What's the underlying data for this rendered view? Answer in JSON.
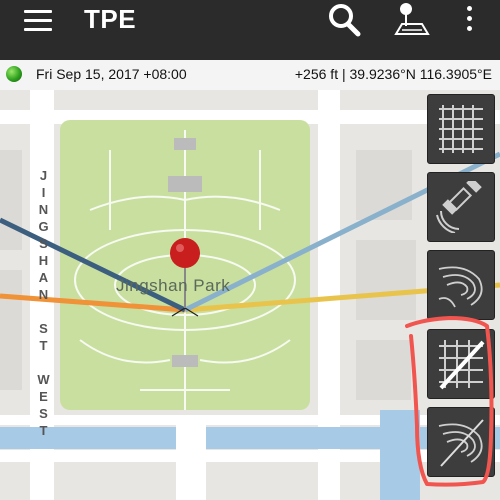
{
  "appbar": {
    "title": "TPE",
    "icons": [
      "menu-icon",
      "search-icon",
      "map-pin-icon",
      "more-vert-icon"
    ]
  },
  "status": {
    "date": "Fri Sep 15, 2017 +08:00",
    "coords": "+256 ft | 39.9236°N 116.3905°E",
    "gps_color": "#2ea01e"
  },
  "map": {
    "road_label": "JINGSHAN ST WEST",
    "park_label": "Jingshan Park",
    "colors": {
      "park": "#c9df9f",
      "water": "#a7cbe6",
      "road": "#ffffff",
      "marker": "#c81e1e",
      "sun_line_orange": "#f09238",
      "sun_line_yellow": "#e9c44d",
      "sun_line_blue": "#8ab1cb",
      "sun_line_navy": "#3c5f80"
    }
  },
  "tools": [
    {
      "name": "grid-icon"
    },
    {
      "name": "satellite-icon"
    },
    {
      "name": "topo-icon"
    },
    {
      "name": "grid-slash-icon"
    },
    {
      "name": "topo-slash-icon"
    }
  ],
  "annotation_color": "#f0564f"
}
